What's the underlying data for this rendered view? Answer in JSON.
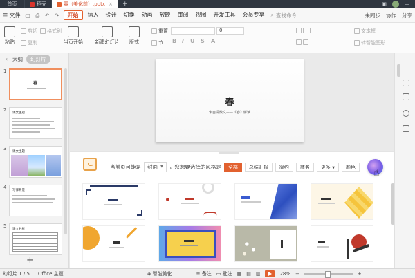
{
  "titlebar": {
    "home_tab": "首页",
    "wps_tab": "稻壳",
    "doc_tab": "春（美化前）.pptx",
    "new_tab_symbol": "+"
  },
  "menubar": {
    "file": "文件",
    "items": [
      "开始",
      "插入",
      "设计",
      "切换",
      "动画",
      "放映",
      "审阅",
      "视图",
      "开发工具",
      "会员专享"
    ],
    "search_placeholder": "查找命令...",
    "right": [
      "未同步",
      "协作",
      "分享"
    ]
  },
  "ribbon": {
    "paste": "粘贴",
    "cut": "剪切",
    "copy": "复制",
    "format_painter": "格式刷",
    "from_current": "当页开始",
    "new_slide": "新建幻灯片",
    "layout": "版式",
    "section": "节",
    "reset": "重置",
    "font_size": "0",
    "text_box": "文本框",
    "shape": "形状",
    "arrange": "排列",
    "picture_text": "转智能图形"
  },
  "left_panel": {
    "tabs": [
      "大纲",
      "幻灯片"
    ],
    "active_tab": "幻灯片",
    "thumb_titles": [
      "春",
      "课文主题",
      "课文主题",
      "写作背景",
      "课文分析"
    ],
    "add_symbol": "+"
  },
  "slide": {
    "title": "春",
    "subtitle": "朱自清散文——《春》解读"
  },
  "beautify": {
    "prompt": "当前页可能是",
    "page_type": "封面",
    "question": "，您想要选择的风格是",
    "styles": [
      "全部",
      "总结汇报",
      "简约",
      "商务",
      "更多"
    ],
    "active_style": "全部",
    "color_label": "颜色"
  },
  "statusbar": {
    "slide_counter": "幻灯片 1 / 5",
    "theme": "Office 主题",
    "smart_beautify": "智能美化",
    "notes": "备注",
    "comments": "批注",
    "zoom": "28%"
  },
  "colors": {
    "accent": "#e2612f",
    "selection": "#f08f5e",
    "titlebar": "#2f3640"
  }
}
